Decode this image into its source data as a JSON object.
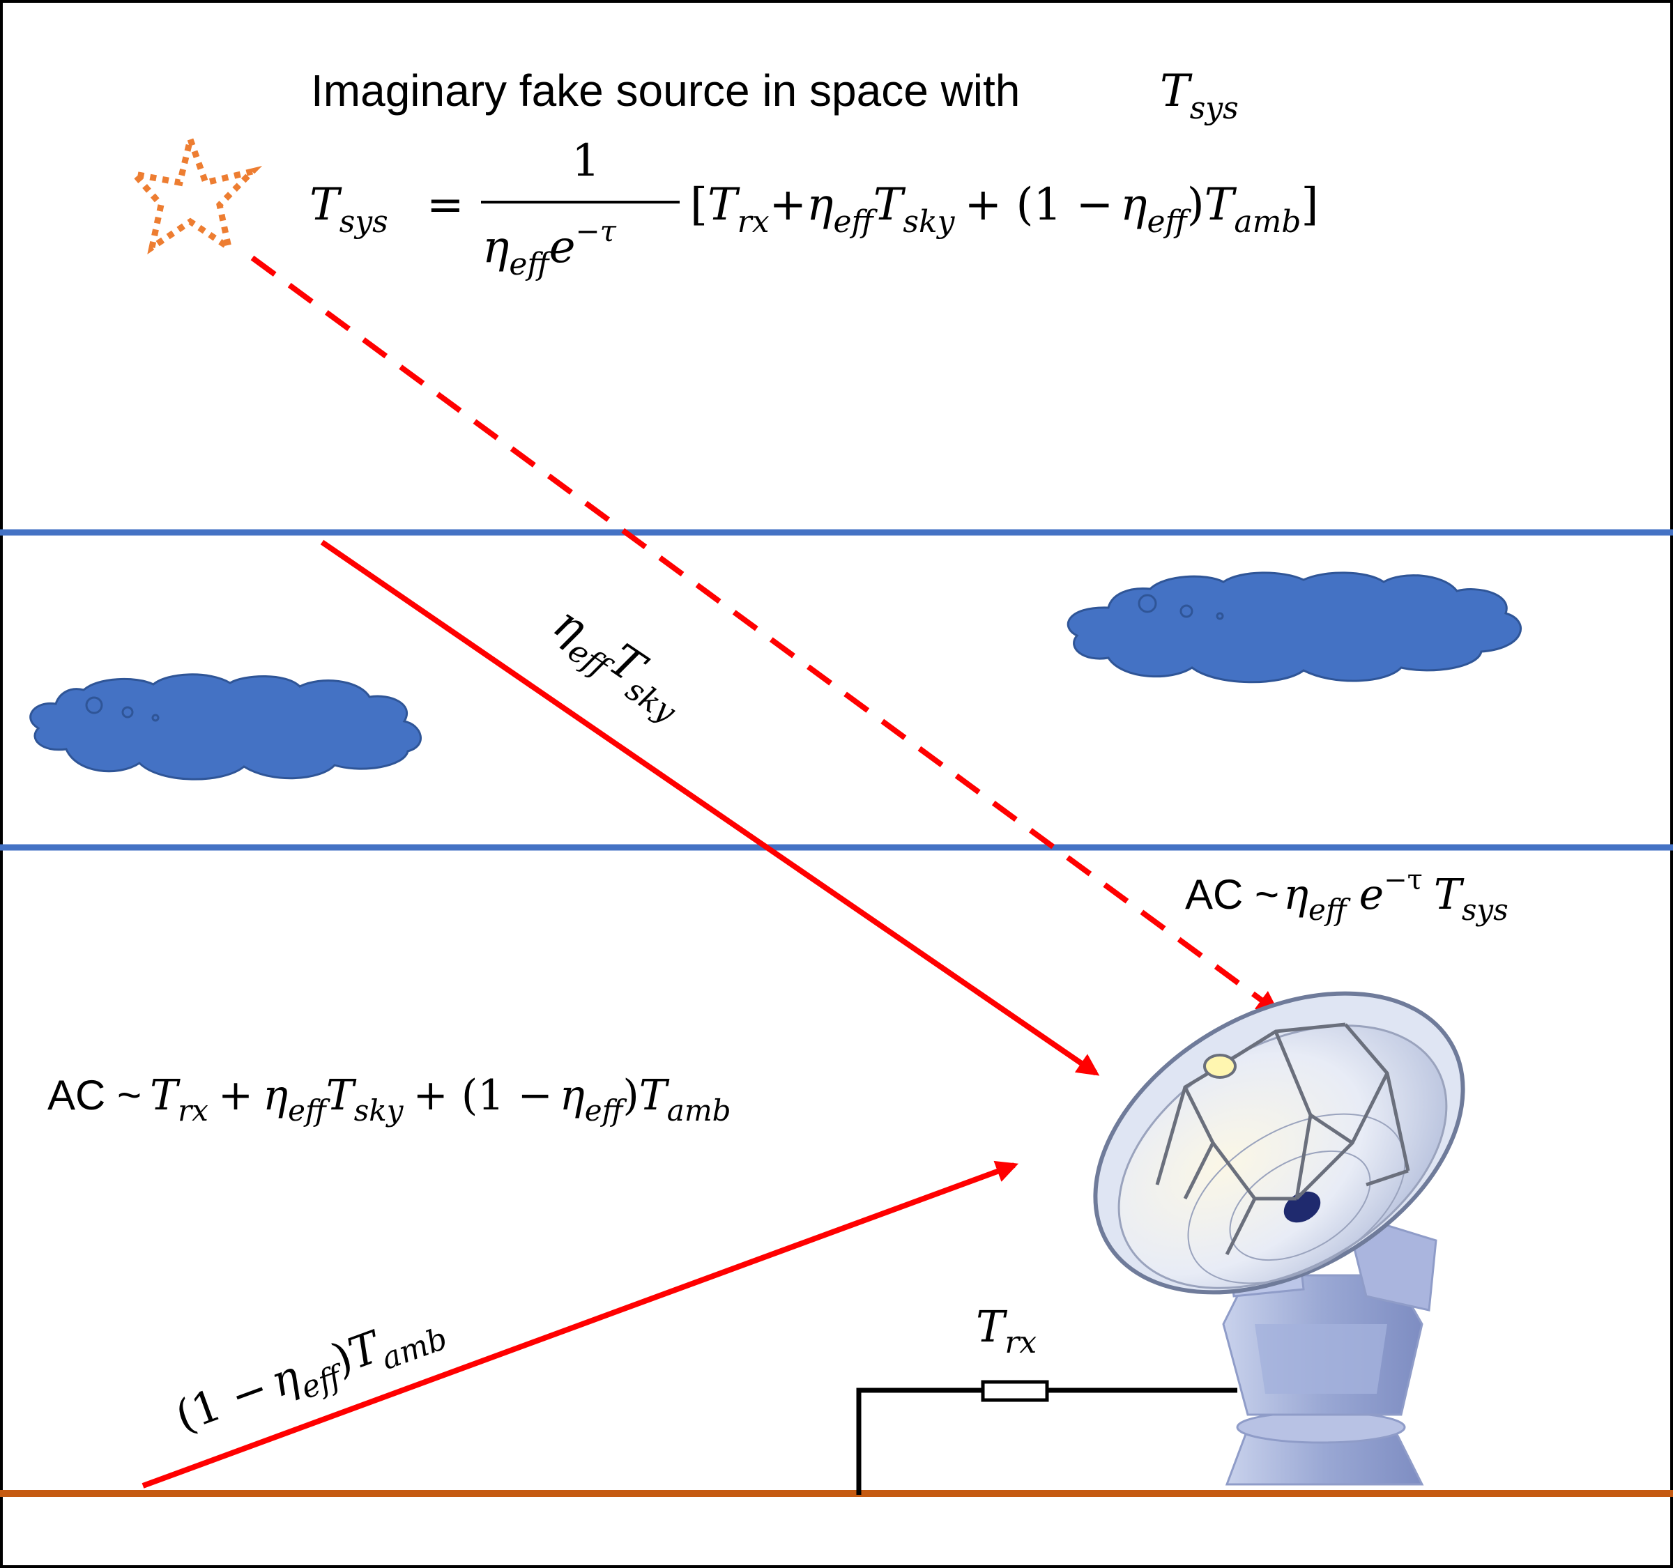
{
  "colors": {
    "frame": "#000000",
    "atmosphere_line": "#4472C4",
    "cloud_fill": "#4472C4",
    "ray": "#FF0000",
    "ground": "#C55A11",
    "star": "#ED7D31",
    "circuit": "#000000"
  },
  "labels": {
    "heading_text": "Imaginary fake source in space with",
    "heading_T": "T",
    "heading_T_sub": "sys",
    "eq_lhs_T": "T",
    "eq_lhs_sub": "sys",
    "eq_equals": "=",
    "eq_numerator": "1",
    "eq_den_eta": "η",
    "eq_den_eta_sub": "eff",
    "eq_den_e": "e",
    "eq_den_exp": "−τ",
    "eq_bracket_open": "[",
    "eq_T1": "T",
    "eq_T1_sub": "rx",
    "eq_plus1": "+",
    "eq_eta1": "η",
    "eq_eta1_sub": "eff",
    "eq_T2": "T",
    "eq_T2_sub": "sky",
    "eq_plus2": "+ (1 −",
    "eq_eta2": "η",
    "eq_eta2_sub": "eff",
    "eq_close_paren": ")",
    "eq_T3": "T",
    "eq_T3_sub": "amb",
    "eq_bracket_close": "]",
    "sky_ray_eta": "η",
    "sky_ray_eta_sub": "eff",
    "sky_ray_T": "T",
    "sky_ray_T_sub": "sky",
    "ac_right_prefix": "AC ~",
    "ac_right_eta": "η",
    "ac_right_eta_sub": "eff",
    "ac_right_e": "e",
    "ac_right_exp": "−τ",
    "ac_right_T": "T",
    "ac_right_T_sub": "sys",
    "ac_left_prefix": "AC ~",
    "ac_left_T1": "T",
    "ac_left_T1_sub": "rx",
    "ac_left_plus1": "+",
    "ac_left_eta1": "η",
    "ac_left_eta1_sub": "eff",
    "ac_left_T2": "T",
    "ac_left_T2_sub": "sky",
    "ac_left_plus2": "+ (1 −",
    "ac_left_eta2": "η",
    "ac_left_eta2_sub": "eff",
    "ac_left_close": ")",
    "ac_left_T3": "T",
    "ac_left_T3_sub": "amb",
    "ground_ray_open": "(1 −",
    "ground_ray_eta": "η",
    "ground_ray_eta_sub": "eff",
    "ground_ray_close": ")",
    "ground_ray_T": "T",
    "ground_ray_T_sub": "amb",
    "receiver_T": "T",
    "receiver_T_sub": "rx"
  }
}
